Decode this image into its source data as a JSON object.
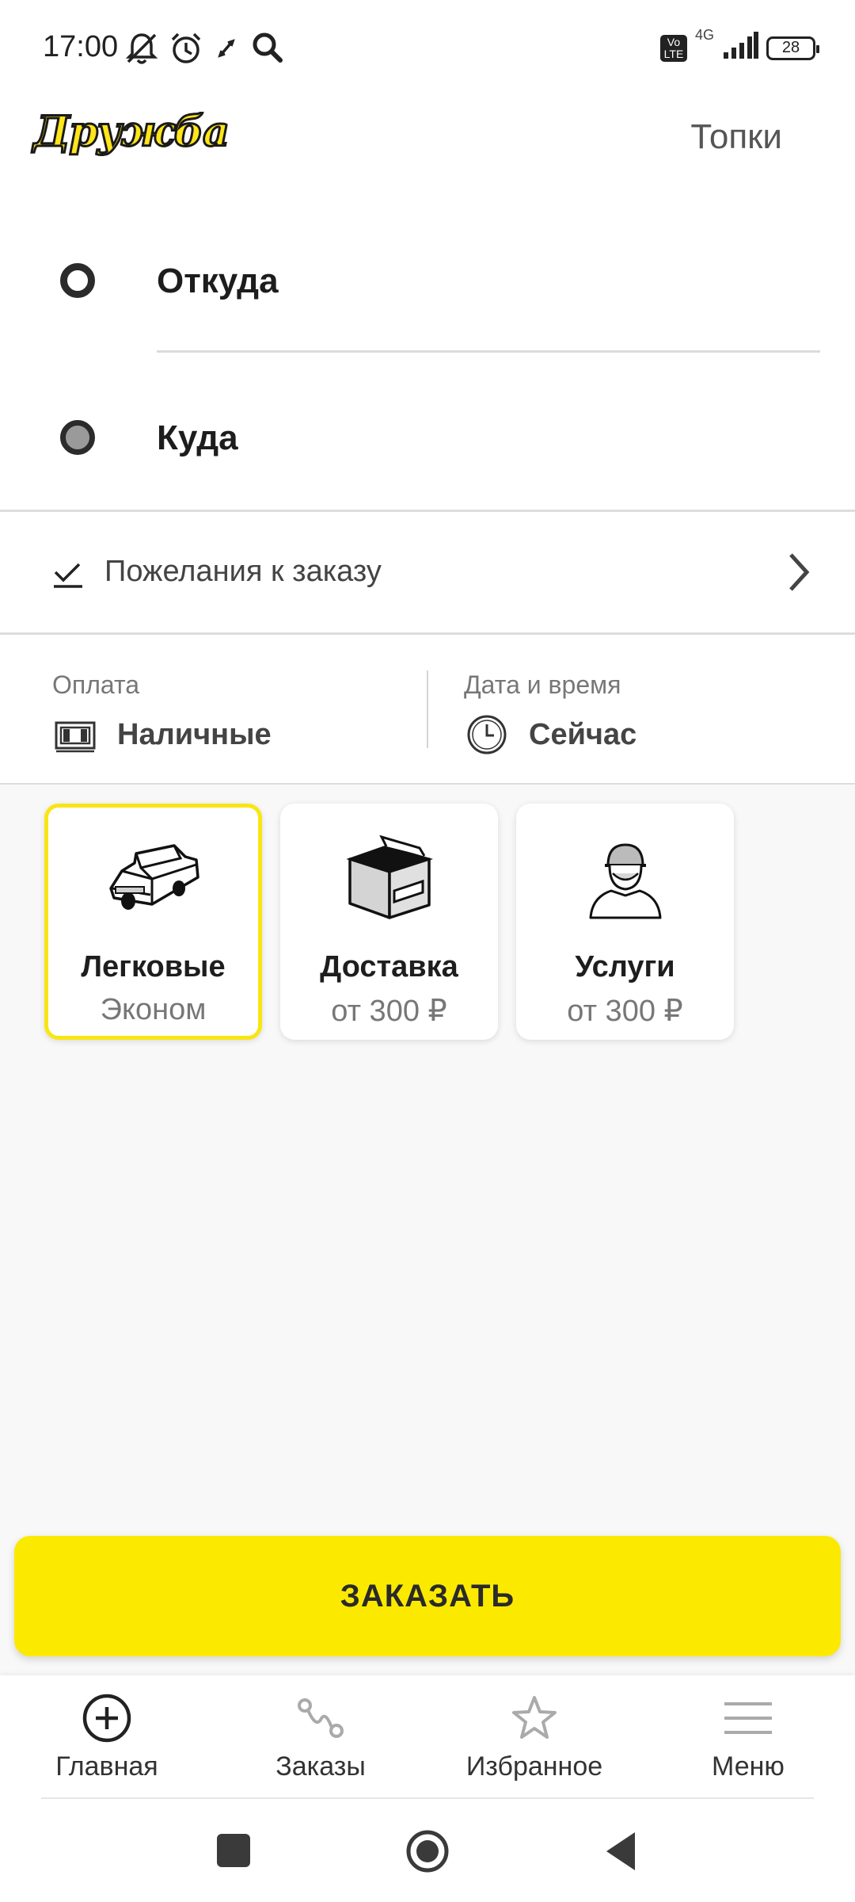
{
  "status_bar": {
    "time": "17:00",
    "network": "4G",
    "volte": "Vo LTE",
    "battery": "28",
    "icons": [
      "bell-off-icon",
      "alarm-icon",
      "sync-icon",
      "search-icon",
      "signal-icon"
    ]
  },
  "header": {
    "logo": "Дружба",
    "city": "Топки"
  },
  "route": {
    "from_label": "Откуда",
    "to_label": "Куда"
  },
  "wishes": {
    "label": "Пожелания к заказу"
  },
  "payment": {
    "label": "Оплата",
    "value": "Наличные"
  },
  "datetime": {
    "label": "Дата и время",
    "value": "Сейчас"
  },
  "tariffs": [
    {
      "title": "Легковые",
      "subtitle": "Эконом",
      "icon": "car-icon",
      "selected": true
    },
    {
      "title": "Доставка",
      "subtitle": "от 300 ₽",
      "icon": "box-icon",
      "selected": false
    },
    {
      "title": "Услуги",
      "subtitle": "от 300 ₽",
      "icon": "worker-icon",
      "selected": false
    }
  ],
  "order_button": "ЗАКАЗАТЬ",
  "bottom_nav": [
    {
      "label": "Главная",
      "icon": "plus-circle-icon"
    },
    {
      "label": "Заказы",
      "icon": "route-icon"
    },
    {
      "label": "Избранное",
      "icon": "star-icon"
    },
    {
      "label": "Меню",
      "icon": "menu-icon"
    }
  ],
  "colors": {
    "accent": "#FBEA00",
    "selected_border": "#F9E514",
    "background_area": "#F8F8F8"
  }
}
